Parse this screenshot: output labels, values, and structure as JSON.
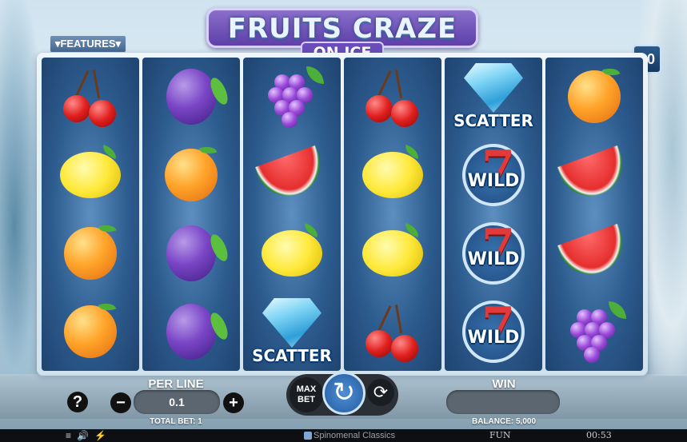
{
  "game": {
    "title": "FRUITS CRAZE",
    "subtitle": "ON ICE",
    "features_label": "▾FEATURES▾",
    "lines_count": "10"
  },
  "reels": [
    [
      "cherry",
      "lemon",
      "orange",
      "orange"
    ],
    [
      "plum",
      "orange",
      "plum",
      "plum"
    ],
    [
      "grapes",
      "watermelon",
      "lemon",
      "scatter"
    ],
    [
      "cherry",
      "lemon",
      "lemon",
      "cherry"
    ],
    [
      "scatter",
      "wild",
      "wild",
      "wild"
    ],
    [
      "orange",
      "watermelon",
      "watermelon",
      "grapes"
    ]
  ],
  "symbol_labels": {
    "scatter": "SCATTER",
    "wild": "WILD",
    "seven": "7"
  },
  "controls": {
    "help": "?",
    "per_line_label": "PER LINE",
    "minus": "−",
    "per_line_value": "0.1",
    "plus": "+",
    "total_bet": "TOTAL BET: 1",
    "max_bet_line1": "MAX",
    "max_bet_line2": "BET",
    "spin_icon": "↻",
    "autoplay_icon": "⟳",
    "win_label": "WIN",
    "win_value": "",
    "balance": "BALANCE: 5,000"
  },
  "status_bar": {
    "menu_icon": "≡",
    "sound_icon": "🔊",
    "turbo_icon": "⚡",
    "brand": "Spinomenal Classics",
    "mode": "FUN",
    "time": "00:53"
  }
}
